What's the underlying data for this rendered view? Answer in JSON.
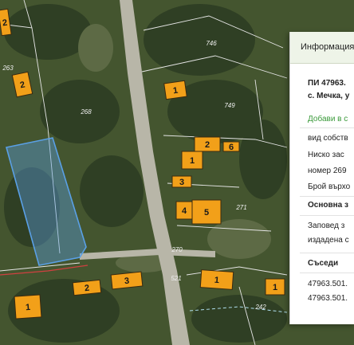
{
  "map": {
    "land_colors": {
      "dark": "#2f3f24",
      "mid": "#44552f",
      "light": "#5d6a45",
      "road": "#b8b6a8"
    },
    "building_color": "#f2a019",
    "parcel_highlight_color": "#5aa0e6",
    "buildings": [
      {
        "label": "2"
      },
      {
        "label": "2"
      },
      {
        "label": "1"
      },
      {
        "label": "2"
      },
      {
        "label": "6"
      },
      {
        "label": "1"
      },
      {
        "label": "3"
      },
      {
        "label": "4"
      },
      {
        "label": "5"
      },
      {
        "label": "2"
      },
      {
        "label": "3"
      },
      {
        "label": "1"
      },
      {
        "label": "1"
      },
      {
        "label": "1"
      }
    ],
    "parcel_numbers": [
      "263",
      "746",
      "749",
      "268",
      "270",
      "271",
      "521",
      "242"
    ]
  },
  "panel": {
    "tab_label": "Информация",
    "title_line1": "ПИ 47963.",
    "title_line2": "с. Мечка, у",
    "add_link": "Добави в с",
    "rows": [
      "вид собств",
      "Ниско зас",
      "номер 269",
      "Брой върхо"
    ],
    "section1_title": "Основна з",
    "section1_rows": [
      "Заповед з",
      "издадена с"
    ],
    "neighbors_title": "Съседи",
    "neighbors": [
      "47963.501.",
      "47963.501."
    ]
  }
}
